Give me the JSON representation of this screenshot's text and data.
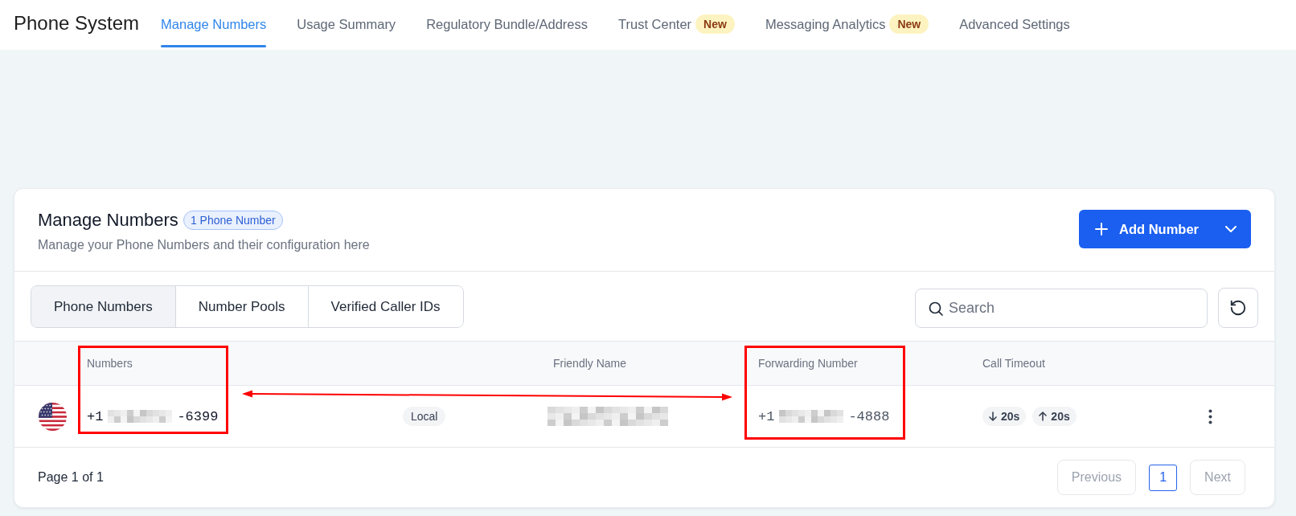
{
  "app": {
    "title": "Phone System"
  },
  "nav_tabs": [
    {
      "label": "Manage Numbers",
      "selected": true
    },
    {
      "label": "Usage Summary",
      "selected": false
    },
    {
      "label": "Regulatory Bundle/Address",
      "selected": false
    },
    {
      "label": "Trust Center",
      "selected": false,
      "badge": "New"
    },
    {
      "label": "Messaging Analytics",
      "selected": false,
      "badge": "New"
    },
    {
      "label": "Advanced Settings",
      "selected": false
    }
  ],
  "card": {
    "title": "Manage Numbers",
    "count_badge": "1 Phone Number",
    "subtitle": "Manage your Phone Numbers and their configuration here",
    "add_button": {
      "label": "Add Number"
    }
  },
  "view_tabs": [
    {
      "label": "Phone Numbers",
      "selected": true
    },
    {
      "label": "Number Pools",
      "selected": false
    },
    {
      "label": "Verified Caller IDs",
      "selected": false
    }
  ],
  "search": {
    "placeholder": "Search"
  },
  "table": {
    "columns": [
      {
        "label": "Numbers",
        "highlighted": true
      },
      {
        "label": "Friendly Name",
        "highlighted": false
      },
      {
        "label": "Forwarding Number",
        "highlighted": true
      },
      {
        "label": "Call Timeout",
        "highlighted": false
      }
    ],
    "rows": [
      {
        "number": {
          "prefix": "+1",
          "suffix": "-6399"
        },
        "type": "Local",
        "forwarding_number": {
          "prefix": "+1",
          "suffix": "-4888"
        },
        "call_timeouts": [
          {
            "kind": "down",
            "value": "20s"
          },
          {
            "kind": "up",
            "value": "20s"
          }
        ]
      }
    ],
    "double_arrow": true
  },
  "pagination": {
    "page_label": "Page 1 of 1",
    "previous": {
      "label": "Previous",
      "disabled": true
    },
    "pages": [
      {
        "label": "1",
        "selected": true
      }
    ],
    "next": {
      "label": "Next",
      "disabled": true
    }
  }
}
